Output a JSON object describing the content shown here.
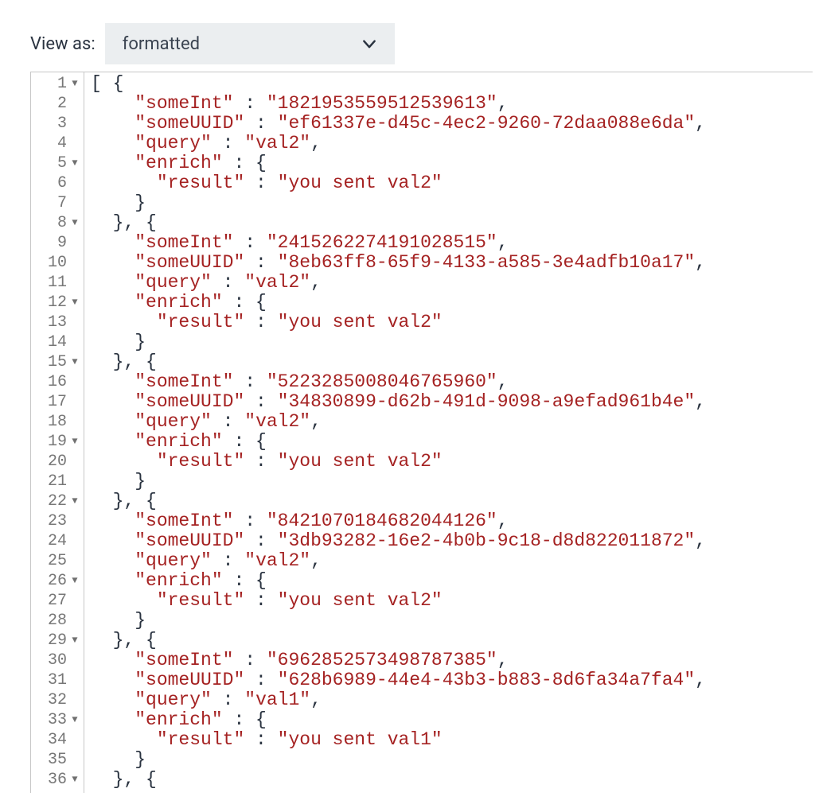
{
  "toolbar": {
    "view_as_label": "View as:",
    "dropdown_value": "formatted"
  },
  "lines": [
    {
      "n": 1,
      "fold": true,
      "tokens": [
        [
          "punc",
          "[ {"
        ]
      ]
    },
    {
      "n": 2,
      "fold": false,
      "tokens": [
        [
          "punc",
          "    "
        ],
        [
          "str",
          "\"someInt\""
        ],
        [
          "punc",
          " : "
        ],
        [
          "str",
          "\"1821953559512539613\""
        ],
        [
          "punc",
          ","
        ]
      ]
    },
    {
      "n": 3,
      "fold": false,
      "tokens": [
        [
          "punc",
          "    "
        ],
        [
          "str",
          "\"someUUID\""
        ],
        [
          "punc",
          " : "
        ],
        [
          "str",
          "\"ef61337e-d45c-4ec2-9260-72daa088e6da\""
        ],
        [
          "punc",
          ","
        ]
      ]
    },
    {
      "n": 4,
      "fold": false,
      "tokens": [
        [
          "punc",
          "    "
        ],
        [
          "str",
          "\"query\""
        ],
        [
          "punc",
          " : "
        ],
        [
          "str",
          "\"val2\""
        ],
        [
          "punc",
          ","
        ]
      ]
    },
    {
      "n": 5,
      "fold": true,
      "tokens": [
        [
          "punc",
          "    "
        ],
        [
          "str",
          "\"enrich\""
        ],
        [
          "punc",
          " : {"
        ]
      ]
    },
    {
      "n": 6,
      "fold": false,
      "tokens": [
        [
          "punc",
          "      "
        ],
        [
          "str",
          "\"result\""
        ],
        [
          "punc",
          " : "
        ],
        [
          "str",
          "\"you sent val2\""
        ]
      ]
    },
    {
      "n": 7,
      "fold": false,
      "tokens": [
        [
          "punc",
          "    }"
        ]
      ]
    },
    {
      "n": 8,
      "fold": true,
      "tokens": [
        [
          "punc",
          "  }, {"
        ]
      ]
    },
    {
      "n": 9,
      "fold": false,
      "tokens": [
        [
          "punc",
          "    "
        ],
        [
          "str",
          "\"someInt\""
        ],
        [
          "punc",
          " : "
        ],
        [
          "str",
          "\"2415262274191028515\""
        ],
        [
          "punc",
          ","
        ]
      ]
    },
    {
      "n": 10,
      "fold": false,
      "tokens": [
        [
          "punc",
          "    "
        ],
        [
          "str",
          "\"someUUID\""
        ],
        [
          "punc",
          " : "
        ],
        [
          "str",
          "\"8eb63ff8-65f9-4133-a585-3e4adfb10a17\""
        ],
        [
          "punc",
          ","
        ]
      ]
    },
    {
      "n": 11,
      "fold": false,
      "tokens": [
        [
          "punc",
          "    "
        ],
        [
          "str",
          "\"query\""
        ],
        [
          "punc",
          " : "
        ],
        [
          "str",
          "\"val2\""
        ],
        [
          "punc",
          ","
        ]
      ]
    },
    {
      "n": 12,
      "fold": true,
      "tokens": [
        [
          "punc",
          "    "
        ],
        [
          "str",
          "\"enrich\""
        ],
        [
          "punc",
          " : {"
        ]
      ]
    },
    {
      "n": 13,
      "fold": false,
      "tokens": [
        [
          "punc",
          "      "
        ],
        [
          "str",
          "\"result\""
        ],
        [
          "punc",
          " : "
        ],
        [
          "str",
          "\"you sent val2\""
        ]
      ]
    },
    {
      "n": 14,
      "fold": false,
      "tokens": [
        [
          "punc",
          "    }"
        ]
      ]
    },
    {
      "n": 15,
      "fold": true,
      "tokens": [
        [
          "punc",
          "  }, {"
        ]
      ]
    },
    {
      "n": 16,
      "fold": false,
      "tokens": [
        [
          "punc",
          "    "
        ],
        [
          "str",
          "\"someInt\""
        ],
        [
          "punc",
          " : "
        ],
        [
          "str",
          "\"5223285008046765960\""
        ],
        [
          "punc",
          ","
        ]
      ]
    },
    {
      "n": 17,
      "fold": false,
      "tokens": [
        [
          "punc",
          "    "
        ],
        [
          "str",
          "\"someUUID\""
        ],
        [
          "punc",
          " : "
        ],
        [
          "str",
          "\"34830899-d62b-491d-9098-a9efad961b4e\""
        ],
        [
          "punc",
          ","
        ]
      ]
    },
    {
      "n": 18,
      "fold": false,
      "tokens": [
        [
          "punc",
          "    "
        ],
        [
          "str",
          "\"query\""
        ],
        [
          "punc",
          " : "
        ],
        [
          "str",
          "\"val2\""
        ],
        [
          "punc",
          ","
        ]
      ]
    },
    {
      "n": 19,
      "fold": true,
      "tokens": [
        [
          "punc",
          "    "
        ],
        [
          "str",
          "\"enrich\""
        ],
        [
          "punc",
          " : {"
        ]
      ]
    },
    {
      "n": 20,
      "fold": false,
      "tokens": [
        [
          "punc",
          "      "
        ],
        [
          "str",
          "\"result\""
        ],
        [
          "punc",
          " : "
        ],
        [
          "str",
          "\"you sent val2\""
        ]
      ]
    },
    {
      "n": 21,
      "fold": false,
      "tokens": [
        [
          "punc",
          "    }"
        ]
      ]
    },
    {
      "n": 22,
      "fold": true,
      "tokens": [
        [
          "punc",
          "  }, {"
        ]
      ]
    },
    {
      "n": 23,
      "fold": false,
      "tokens": [
        [
          "punc",
          "    "
        ],
        [
          "str",
          "\"someInt\""
        ],
        [
          "punc",
          " : "
        ],
        [
          "str",
          "\"8421070184682044126\""
        ],
        [
          "punc",
          ","
        ]
      ]
    },
    {
      "n": 24,
      "fold": false,
      "tokens": [
        [
          "punc",
          "    "
        ],
        [
          "str",
          "\"someUUID\""
        ],
        [
          "punc",
          " : "
        ],
        [
          "str",
          "\"3db93282-16e2-4b0b-9c18-d8d822011872\""
        ],
        [
          "punc",
          ","
        ]
      ]
    },
    {
      "n": 25,
      "fold": false,
      "tokens": [
        [
          "punc",
          "    "
        ],
        [
          "str",
          "\"query\""
        ],
        [
          "punc",
          " : "
        ],
        [
          "str",
          "\"val2\""
        ],
        [
          "punc",
          ","
        ]
      ]
    },
    {
      "n": 26,
      "fold": true,
      "tokens": [
        [
          "punc",
          "    "
        ],
        [
          "str",
          "\"enrich\""
        ],
        [
          "punc",
          " : {"
        ]
      ]
    },
    {
      "n": 27,
      "fold": false,
      "tokens": [
        [
          "punc",
          "      "
        ],
        [
          "str",
          "\"result\""
        ],
        [
          "punc",
          " : "
        ],
        [
          "str",
          "\"you sent val2\""
        ]
      ]
    },
    {
      "n": 28,
      "fold": false,
      "tokens": [
        [
          "punc",
          "    }"
        ]
      ]
    },
    {
      "n": 29,
      "fold": true,
      "tokens": [
        [
          "punc",
          "  }, {"
        ]
      ]
    },
    {
      "n": 30,
      "fold": false,
      "tokens": [
        [
          "punc",
          "    "
        ],
        [
          "str",
          "\"someInt\""
        ],
        [
          "punc",
          " : "
        ],
        [
          "str",
          "\"6962852573498787385\""
        ],
        [
          "punc",
          ","
        ]
      ]
    },
    {
      "n": 31,
      "fold": false,
      "tokens": [
        [
          "punc",
          "    "
        ],
        [
          "str",
          "\"someUUID\""
        ],
        [
          "punc",
          " : "
        ],
        [
          "str",
          "\"628b6989-44e4-43b3-b883-8d6fa34a7fa4\""
        ],
        [
          "punc",
          ","
        ]
      ]
    },
    {
      "n": 32,
      "fold": false,
      "tokens": [
        [
          "punc",
          "    "
        ],
        [
          "str",
          "\"query\""
        ],
        [
          "punc",
          " : "
        ],
        [
          "str",
          "\"val1\""
        ],
        [
          "punc",
          ","
        ]
      ]
    },
    {
      "n": 33,
      "fold": true,
      "tokens": [
        [
          "punc",
          "    "
        ],
        [
          "str",
          "\"enrich\""
        ],
        [
          "punc",
          " : {"
        ]
      ]
    },
    {
      "n": 34,
      "fold": false,
      "tokens": [
        [
          "punc",
          "      "
        ],
        [
          "str",
          "\"result\""
        ],
        [
          "punc",
          " : "
        ],
        [
          "str",
          "\"you sent val1\""
        ]
      ]
    },
    {
      "n": 35,
      "fold": false,
      "tokens": [
        [
          "punc",
          "    }"
        ]
      ]
    },
    {
      "n": 36,
      "fold": true,
      "tokens": [
        [
          "punc",
          "  }, {"
        ]
      ]
    }
  ]
}
